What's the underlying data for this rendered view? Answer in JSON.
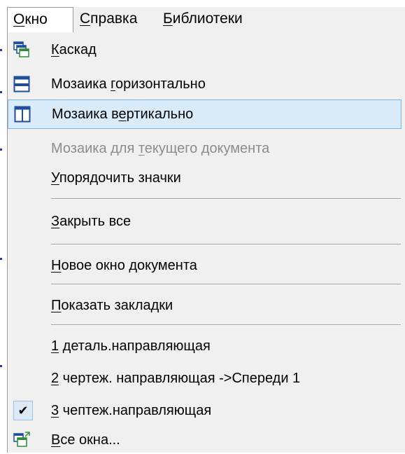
{
  "menubar": {
    "items": [
      {
        "pre": "",
        "u": "О",
        "post": "кно"
      },
      {
        "pre": "",
        "u": "С",
        "post": "правка"
      },
      {
        "pre": "",
        "u": "Б",
        "post": "иблиотеки"
      }
    ]
  },
  "menu": {
    "items": [
      {
        "pre": "",
        "u": "К",
        "post": "аскад",
        "icon": "cascade-windows-icon",
        "state": "normal"
      },
      {
        "pre": "Мозаика ",
        "u": "г",
        "post": "оризонтально",
        "icon": "tile-horizontal-icon",
        "state": "normal"
      },
      {
        "pre": "Мозаика в",
        "u": "е",
        "post": "ртикально",
        "icon": "tile-vertical-icon",
        "state": "highlighted"
      },
      {
        "pre": "Мозаика для ",
        "u": "т",
        "post": "екущего документа",
        "icon": "",
        "state": "disabled"
      },
      {
        "pre": "",
        "u": "У",
        "post": "порядочить значки",
        "icon": "",
        "state": "normal"
      },
      {
        "pre": "",
        "u": "З",
        "post": "акрыть все",
        "icon": "",
        "state": "normal"
      },
      {
        "pre": "",
        "u": "Н",
        "post": "овое окно документа",
        "icon": "",
        "state": "normal"
      },
      {
        "pre": "",
        "u": "П",
        "post": "оказать закладки",
        "icon": "",
        "state": "normal"
      },
      {
        "pre": "",
        "u": "1",
        "post": " деталь.направляющая",
        "icon": "",
        "state": "normal"
      },
      {
        "pre": "",
        "u": "2",
        "post": " чертеж. направляющая ->Спереди 1",
        "icon": "",
        "state": "normal"
      },
      {
        "pre": "",
        "u": "3",
        "post": " чептеж.направляющая",
        "icon": "checkmark-icon",
        "state": "checked"
      },
      {
        "pre": "",
        "u": "В",
        "post": "се окна...",
        "icon": "all-windows-icon",
        "state": "normal"
      }
    ]
  },
  "colors": {
    "highlight_bg": "#d9eaf8",
    "highlight_border": "#7fb4e0",
    "disabled_text": "#8c8c8c",
    "icon_blue": "#1f4e9a",
    "icon_green": "#2e8b3a"
  }
}
